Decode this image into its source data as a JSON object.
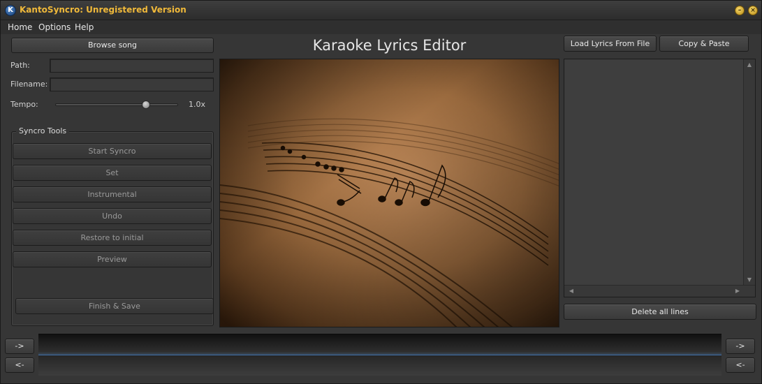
{
  "window": {
    "title": "KantoSyncro: Unregistered Version",
    "icon_letter": "K",
    "minimize_glyph": "–",
    "close_glyph": "×"
  },
  "menu": {
    "items": [
      {
        "label": "Home"
      },
      {
        "label": "Options"
      },
      {
        "label": "Help"
      }
    ]
  },
  "left": {
    "browse_label": "Browse song",
    "path_label": "Path:",
    "path_value": "",
    "filename_label": "Filename:",
    "filename_value": "",
    "tempo_label": "Tempo:",
    "tempo_value": "1.0x",
    "tempo_slider_fraction": 0.74
  },
  "syncro_tools": {
    "title": "Syncro Tools",
    "buttons": [
      {
        "label": "Start Syncro"
      },
      {
        "label": "Set"
      },
      {
        "label": "Instrumental"
      },
      {
        "label": "Undo"
      },
      {
        "label": "Restore to initial"
      },
      {
        "label": "Preview"
      }
    ],
    "finish_label": "Finish & Save"
  },
  "center": {
    "heading": "Karaoke Lyrics Editor",
    "image_subject": "sheet-music-with-notes"
  },
  "right": {
    "load_label": "Load Lyrics From File",
    "paste_label": "Copy & Paste",
    "delete_label": "Delete all lines",
    "lyrics_lines": []
  },
  "timeline": {
    "forward_label": "->",
    "back_label": "<-"
  },
  "colors": {
    "title_accent": "#f0b93a",
    "timeline_accent": "#3f6ea8",
    "image_sepia": "#8a5a30"
  }
}
